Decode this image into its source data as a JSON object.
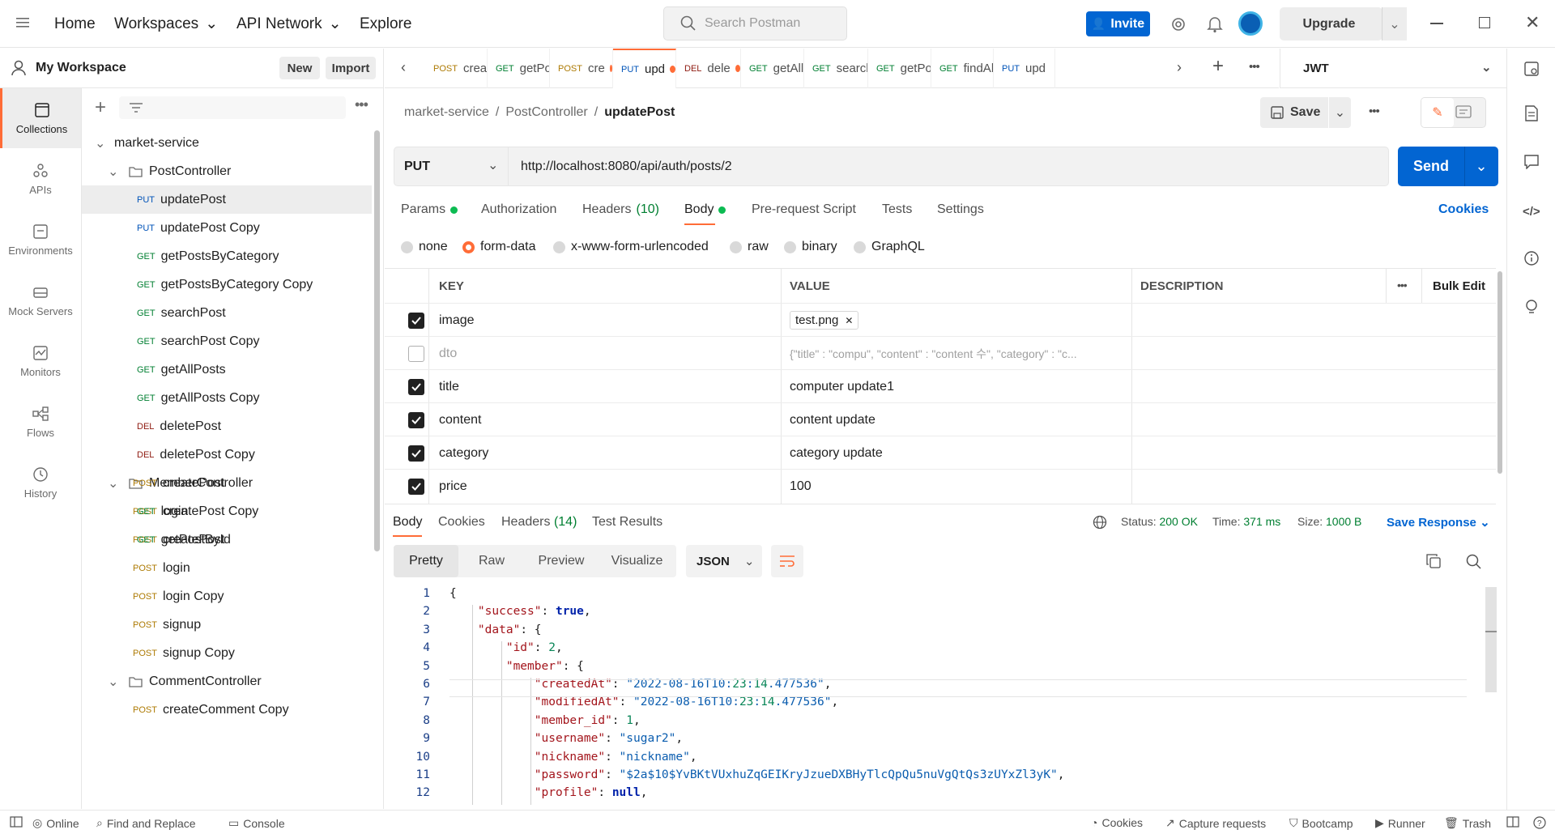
{
  "topbar": {
    "nav": [
      "Home",
      "Workspaces",
      "API Network",
      "Explore"
    ],
    "search_placeholder": "Search Postman",
    "invite_label": "Invite",
    "upgrade_label": "Upgrade"
  },
  "workspace": {
    "name": "My Workspace",
    "new_label": "New",
    "import_label": "Import"
  },
  "rail": [
    "Collections",
    "APIs",
    "Environments",
    "Mock Servers",
    "Monitors",
    "Flows",
    "History"
  ],
  "tree": {
    "collection": "market-service",
    "folders": [
      "PostController",
      "MemberController",
      "CommentController"
    ],
    "items": [
      {
        "m": "PUT",
        "n": "updatePost"
      },
      {
        "m": "PUT",
        "n": "updatePost Copy"
      },
      {
        "m": "GET",
        "n": "getPostsByCategory"
      },
      {
        "m": "GET",
        "n": "getPostsByCategory Copy"
      },
      {
        "m": "GET",
        "n": "searchPost"
      },
      {
        "m": "GET",
        "n": "searchPost Copy"
      },
      {
        "m": "GET",
        "n": "getAllPosts"
      },
      {
        "m": "GET",
        "n": "getAllPosts Copy"
      },
      {
        "m": "DEL",
        "n": "deletePost"
      },
      {
        "m": "DEL",
        "n": "deletePost Copy"
      },
      {
        "m": "POST",
        "n": "createPost"
      },
      {
        "m": "POST",
        "n": "createPost Copy"
      },
      {
        "m": "POST",
        "n": "createPost"
      },
      {
        "m": "GET",
        "n": "login"
      },
      {
        "m": "GET",
        "n": "getPostById"
      },
      {
        "m": "POST",
        "n": "login"
      },
      {
        "m": "POST",
        "n": "login Copy"
      },
      {
        "m": "POST",
        "n": "signup"
      },
      {
        "m": "POST",
        "n": "signup Copy"
      },
      {
        "m": "POST",
        "n": "createComment Copy"
      }
    ]
  },
  "tabs": [
    {
      "m": "POST",
      "n": "create",
      "dot": false
    },
    {
      "m": "GET",
      "n": "getPos",
      "dot": false
    },
    {
      "m": "POST",
      "n": "cre",
      "dot": true
    },
    {
      "m": "PUT",
      "n": "upd",
      "dot": true
    },
    {
      "m": "DEL",
      "n": "dele",
      "dot": true
    },
    {
      "m": "GET",
      "n": "getAllP",
      "dot": false
    },
    {
      "m": "GET",
      "n": "search",
      "dot": false
    },
    {
      "m": "GET",
      "n": "getPos",
      "dot": false
    },
    {
      "m": "GET",
      "n": "findAll",
      "dot": false
    },
    {
      "m": "PUT",
      "n": "upd",
      "dot": false
    }
  ],
  "environment": "JWT",
  "breadcrumb": {
    "a": "market-service",
    "b": "PostController",
    "c": "updatePost",
    "sep": "/"
  },
  "save_label": "Save",
  "request": {
    "method": "PUT",
    "url": "http://localhost:8080/api/auth/posts/2",
    "send_label": "Send"
  },
  "req_tabs": {
    "params": "Params",
    "authorization": "Authorization",
    "headers": "Headers",
    "headers_count": "(10)",
    "body": "Body",
    "prerequest": "Pre-request Script",
    "tests": "Tests",
    "settings": "Settings",
    "cookies": "Cookies"
  },
  "body_modes": [
    "none",
    "form-data",
    "x-www-form-urlencoded",
    "raw",
    "binary",
    "GraphQL"
  ],
  "kv_headers": {
    "key": "KEY",
    "value": "VALUE",
    "description": "DESCRIPTION",
    "bulk": "Bulk Edit"
  },
  "kv_rows": [
    {
      "k": "image",
      "v": "test.png",
      "checked": true,
      "file": true
    },
    {
      "k": "dto",
      "v": "{\"title\" : \"compu\", \"content\" : \"content 수\", \"category\" : \"c...",
      "checked": false,
      "file": false
    },
    {
      "k": "title",
      "v": "computer update1",
      "checked": true,
      "file": false
    },
    {
      "k": "content",
      "v": "content update",
      "checked": true,
      "file": false
    },
    {
      "k": "category",
      "v": "category update",
      "checked": true,
      "file": false
    },
    {
      "k": "price",
      "v": "100",
      "checked": true,
      "file": false
    }
  ],
  "response": {
    "tabs": {
      "body": "Body",
      "cookies": "Cookies",
      "headers": "Headers",
      "headers_count": "(14)",
      "tests": "Test Results"
    },
    "status_label": "Status:",
    "status": "200 OK",
    "time_label": "Time:",
    "time": "371 ms",
    "size_label": "Size:",
    "size": "1000 B",
    "save_label": "Save Response",
    "views": [
      "Pretty",
      "Raw",
      "Preview",
      "Visualize"
    ],
    "format": "JSON"
  },
  "code_lines": [
    "{",
    "    \"success\": true,",
    "    \"data\": {",
    "        \"id\": 2,",
    "        \"member\": {",
    "            \"createdAt\": \"2022-08-16T10:23:14.477536\",",
    "            \"modifiedAt\": \"2022-08-16T10:23:14.477536\",",
    "            \"member_id\": 1,",
    "            \"username\": \"sugar2\",",
    "            \"nickname\": \"nickname\",",
    "            \"password\": \"$2a$10$YvBKtVUxhuZqGEIKryJzueDXBHyTlcQpQu5nuVgQtQs3zUYxZl3yK\",",
    "            \"profile\": null,"
  ],
  "statusbar": {
    "online": "Online",
    "find": "Find and Replace",
    "console": "Console",
    "cookies": "Cookies",
    "capture": "Capture requests",
    "bootcamp": "Bootcamp",
    "runner": "Runner",
    "trash": "Trash"
  },
  "colors": {
    "accent": "#ff6c37",
    "primary": "#0265d2",
    "get": "#007f31",
    "post": "#ad7a03",
    "put": "#0053b8",
    "del": "#8e1a10"
  }
}
